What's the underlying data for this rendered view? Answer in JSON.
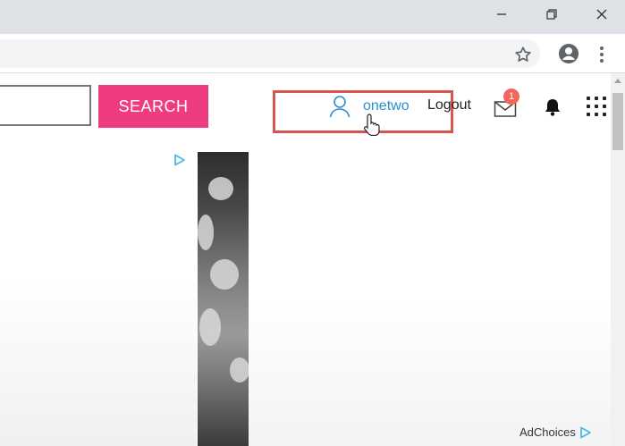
{
  "window": {
    "minimize_icon": "minimize-icon",
    "restore_icon": "restore-icon",
    "close_icon": "close-icon"
  },
  "toolbar": {
    "bookmark_icon": "star-icon",
    "profile_icon": "account-icon",
    "menu_icon": "kebab-menu-icon"
  },
  "header": {
    "search_button": "SEARCH",
    "search_placeholder": "",
    "username": "onetwo",
    "logout": "Logout",
    "mail_badge": "1"
  },
  "ad": {
    "adchoices_label": "AdChoices"
  },
  "colors": {
    "search_button": "#ef3b80",
    "username": "#2a8fd1",
    "highlight": "#d9534f",
    "badge": "#f2665b"
  }
}
